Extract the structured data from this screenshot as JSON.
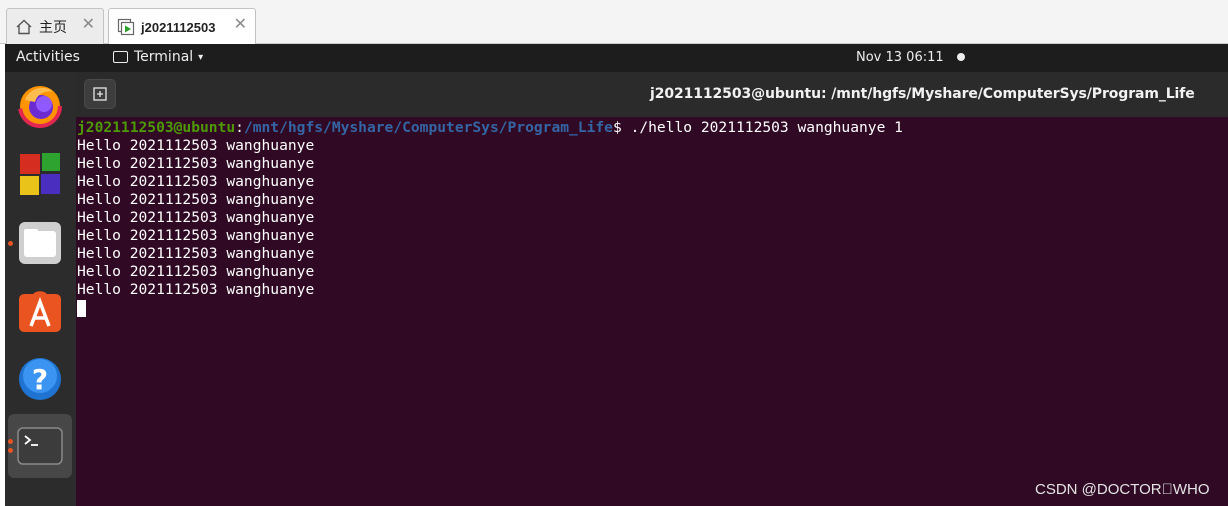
{
  "vmware_tabs": [
    {
      "label": "主页",
      "icon": "home-icon",
      "close": "✕"
    },
    {
      "label": "j2021112503",
      "icon": "vm-icon",
      "close": "✕"
    }
  ],
  "topbar": {
    "activities": "Activities",
    "app_menu": "Terminal",
    "app_menu_caret": "▾",
    "clock": "Nov 13  06:11"
  },
  "dock": {
    "items": [
      "firefox-icon",
      "libreoffice-icon",
      "files-icon",
      "software-store-icon",
      "help-icon",
      "terminal-icon"
    ]
  },
  "terminal": {
    "title": "j2021112503@ubuntu: /mnt/hgfs/Myshare/ComputerSys/Program_Life",
    "prompt_user": "j2021112503@ubuntu",
    "prompt_sep": ":",
    "prompt_path": "/mnt/hgfs/Myshare/ComputerSys/Program_Life",
    "prompt_end": "$ ",
    "command": "./hello 2021112503 wanghuanye 1",
    "output": [
      "Hello 2021112503 wanghuanye",
      "Hello 2021112503 wanghuanye",
      "Hello 2021112503 wanghuanye",
      "Hello 2021112503 wanghuanye",
      "Hello 2021112503 wanghuanye",
      "Hello 2021112503 wanghuanye",
      "Hello 2021112503 wanghuanye",
      "Hello 2021112503 wanghuanye",
      "Hello 2021112503 wanghuanye"
    ]
  },
  "watermark": "CSDN @DOCTOR\u0000WHO",
  "colors": {
    "terminal_bg": "#300a24",
    "prompt_user": "#4e9a06",
    "prompt_path": "#3465a4",
    "ubuntu_orange": "#e95420"
  }
}
